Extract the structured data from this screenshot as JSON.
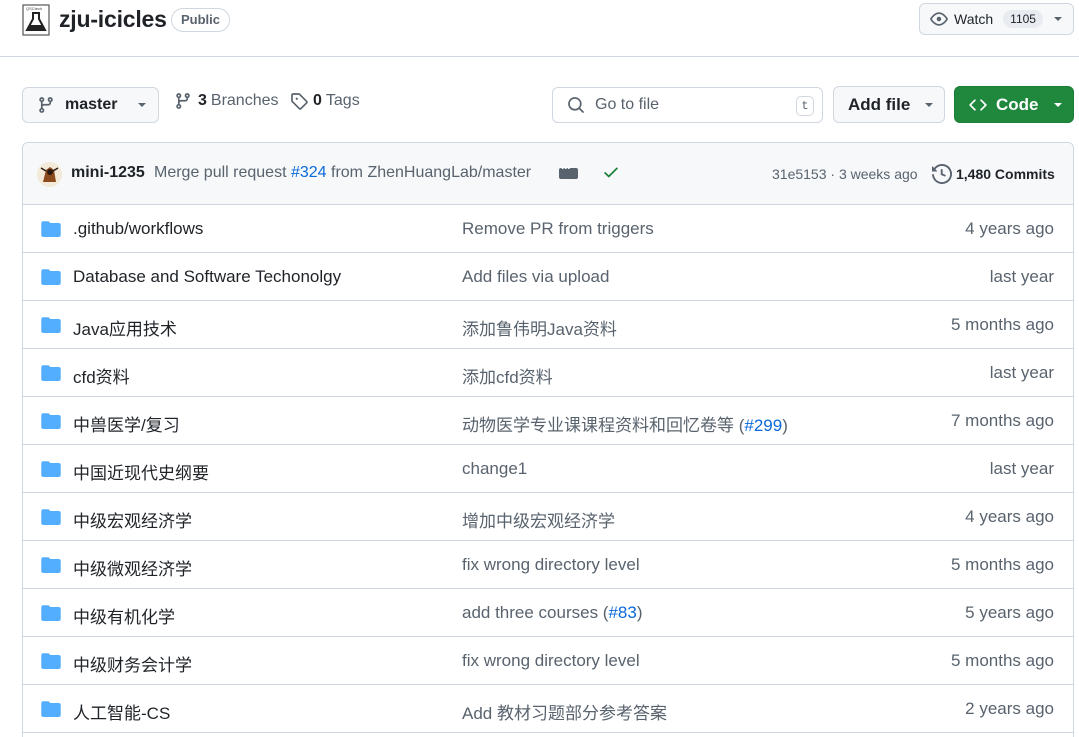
{
  "header": {
    "repo_name": "zju-icicles",
    "visibility": "Public",
    "watch_label": "Watch",
    "watch_count": "1105"
  },
  "toolbar": {
    "branch": "master",
    "branches_count": "3",
    "branches_label": "Branches",
    "tags_count": "0",
    "tags_label": "Tags",
    "goto_placeholder": "Go to file",
    "goto_shortcut": "t",
    "add_file_label": "Add file",
    "code_label": "Code"
  },
  "latest_commit": {
    "author": "mini-1235",
    "message_prefix": "Merge pull request ",
    "pr": "#324",
    "message_suffix": " from ZhenHuangLab/master",
    "hash_date": "31e5153 · 3 weeks ago",
    "commits": "1,480 Commits"
  },
  "files": [
    {
      "name": ".github/workflows",
      "message": "Remove PR from triggers",
      "pr": "",
      "date": "4 years ago"
    },
    {
      "name": "Database and Software Techonolgy",
      "message": "Add files via upload",
      "pr": "",
      "date": "last year"
    },
    {
      "name": "Java应用技术",
      "message": "添加鲁伟明Java资料",
      "pr": "",
      "date": "5 months ago"
    },
    {
      "name": "cfd资料",
      "message": "添加cfd资料",
      "pr": "",
      "date": "last year"
    },
    {
      "name": "中兽医学/复习",
      "message": "动物医学专业课课程资料和回忆卷等 (",
      "pr": "#299",
      "date": "7 months ago"
    },
    {
      "name": "中国近现代史纲要",
      "message": "change1",
      "pr": "",
      "date": "last year"
    },
    {
      "name": "中级宏观经济学",
      "message": "增加中级宏观经济学",
      "pr": "",
      "date": "4 years ago"
    },
    {
      "name": "中级微观经济学",
      "message": "fix wrong directory level",
      "pr": "",
      "date": "5 months ago"
    },
    {
      "name": "中级有机化学",
      "message": "add three courses (",
      "pr": "#83",
      "date": "5 years ago"
    },
    {
      "name": "中级财务会计学",
      "message": "fix wrong directory level",
      "pr": "",
      "date": "5 months ago"
    },
    {
      "name": "人工智能-CS",
      "message": "Add 教材习题部分参考答案",
      "pr": "",
      "date": "2 years ago"
    }
  ],
  "colors": {
    "folder": "#54aeff",
    "link": "#0969da",
    "code_button": "#1f883d",
    "success": "#1a7f37"
  }
}
